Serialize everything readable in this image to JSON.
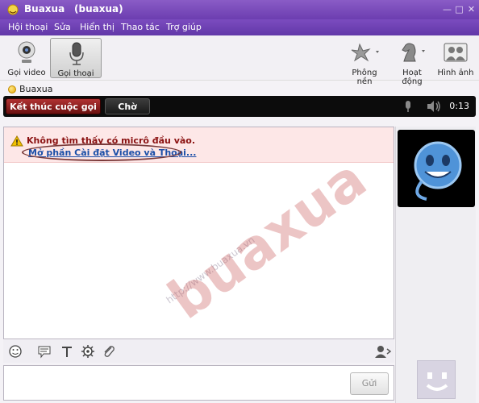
{
  "window": {
    "title": "Buaxua",
    "subtitle": "(buaxua)",
    "controls": [
      "—",
      "□",
      "✕"
    ]
  },
  "menu": [
    "Hội thoại",
    "Sửa",
    "Hiển thị",
    "Thao tác",
    "Trợ giúp"
  ],
  "toolbar": {
    "video_call": "Gọi video",
    "voice_call": "Gọi thoại",
    "background": "Phông nền",
    "activities": "Hoạt động",
    "photos": "Hình ảnh"
  },
  "contact": {
    "name": "Buaxua",
    "status_color": "#f5c400"
  },
  "call": {
    "end_label": "Kết thúc cuộc gọi",
    "hold_label": "Chờ",
    "timer": "0:13"
  },
  "warning": {
    "message": "Không tìm thấy có micrô đầu vào.",
    "link": "Mở phần Cài đặt Video và Thoại..."
  },
  "watermark": {
    "url": "http://www.buaxua.vn",
    "logo": "buaxua"
  },
  "compose": {
    "send_label": "Gửi"
  },
  "colors": {
    "accent": "#6c3db0",
    "end_call": "#b23232",
    "link": "#1b4fa8"
  }
}
